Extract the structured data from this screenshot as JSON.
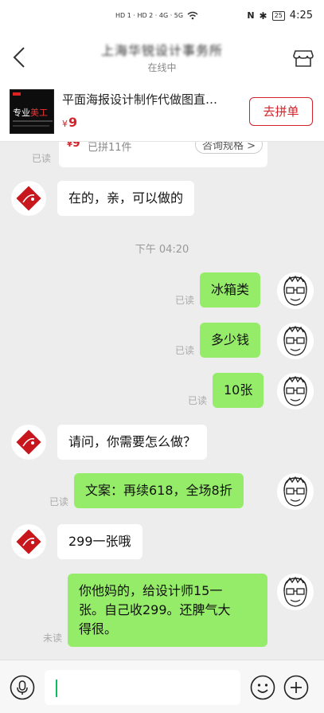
{
  "status_bar": {
    "left_indicators": "HD 1 · HD 2 · 4G · 5G",
    "time": "4:25",
    "battery": "25"
  },
  "header": {
    "title": "上海华锐设计事务所",
    "subtitle": "在线中"
  },
  "product": {
    "thumb_text_a": "专业",
    "thumb_text_b": "美工",
    "name": "平面海报设计制作代做图直…",
    "price_symbol": "¥",
    "price": "9",
    "button": "去拼单"
  },
  "top_card": {
    "price_symbol": "¥",
    "price": "9",
    "count": "已拼11件",
    "spec": "咨询规格 >",
    "read": "已读"
  },
  "messages": [
    {
      "side": "in",
      "text": "在的，亲，可以做的"
    },
    {
      "side": "time",
      "text": "下午 04:20"
    },
    {
      "side": "out",
      "text": "冰箱类",
      "read": "已读"
    },
    {
      "side": "out",
      "text": "多少钱",
      "read": "已读"
    },
    {
      "side": "out",
      "text": "10张",
      "read": "已读"
    },
    {
      "side": "in",
      "text": "请问，你需要怎么做？"
    },
    {
      "side": "out",
      "text": "文案：再续618，全场8折",
      "read": "已读"
    },
    {
      "side": "in",
      "text": "299一张哦"
    },
    {
      "side": "out",
      "line1": "你他妈的，给设计师15一",
      "line2": "张。自己收299。还脾气大",
      "line3": "得很。",
      "read": "未读"
    }
  ],
  "colors": {
    "accent": "#d3232a",
    "out_bubble": "#95ec69",
    "background": "#ededed"
  }
}
